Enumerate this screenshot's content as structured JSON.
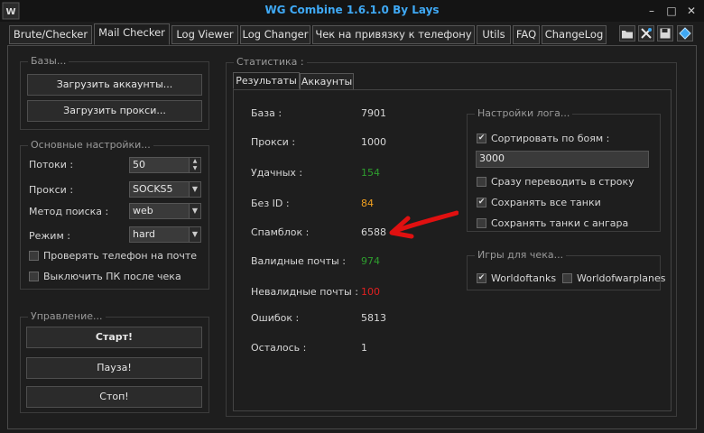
{
  "window": {
    "title": "WG Combine 1.6.1.0 By Lays",
    "minimize": "–",
    "maximize": "□",
    "close": "✕"
  },
  "tabs": [
    {
      "label": "Brute/Checker"
    },
    {
      "label": "Mail Checker",
      "active": true
    },
    {
      "label": "Log  Viewer"
    },
    {
      "label": "Log Changer"
    },
    {
      "label": "Чек на привязку к телефону"
    },
    {
      "label": "Utils"
    },
    {
      "label": "FAQ"
    },
    {
      "label": "ChangeLog"
    }
  ],
  "toolbar_icons": [
    "folder-icon",
    "tools-icon",
    "save-icon",
    "settings-icon"
  ],
  "bases": {
    "title": "Базы...",
    "load_accounts": "Загрузить аккаунты...",
    "load_proxy": "Загрузить прокси..."
  },
  "settings": {
    "title": "Основные настройки...",
    "threads_label": "Потоки :",
    "threads_value": "50",
    "proxy_label": "Прокси :",
    "proxy_value": "SOCKS5",
    "search_label": "Метод поиска :",
    "search_value": "web",
    "mode_label": "Режим  :",
    "mode_value": "hard",
    "check_phone": {
      "label": "Проверять телефон на почте",
      "checked": false
    },
    "shutdown_pc": {
      "label": "Выключить ПК после чека",
      "checked": false
    }
  },
  "control": {
    "title": "Управление...",
    "start": "Старт!",
    "pause": "Пауза!",
    "stop": "Стоп!"
  },
  "stats": {
    "title": "Статистика :",
    "tabs": [
      "Результаты",
      "Аккаунты"
    ],
    "rows": [
      {
        "label": "База :",
        "value": "7901",
        "color": "#d6d6d6"
      },
      {
        "label": "Прокси :",
        "value": "1000",
        "color": "#d6d6d6"
      },
      {
        "label": "Удачных :",
        "value": "154",
        "color": "#2e9e2e"
      },
      {
        "label": "Без ID :",
        "value": "84",
        "color": "#f0a020"
      },
      {
        "label": "Спамблок :",
        "value": "6588",
        "color": "#d6d6d6"
      },
      {
        "label": "Валидные почты :",
        "value": "974",
        "color": "#2e9e2e"
      },
      {
        "label": "Невалидные почты :",
        "value": "100",
        "color": "#e02020"
      },
      {
        "label": "Ошибок :",
        "value": "5813",
        "color": "#d6d6d6"
      },
      {
        "label": "Осталось :",
        "value": "1",
        "color": "#d6d6d6"
      }
    ]
  },
  "log_settings": {
    "title": "Настройки лога...",
    "sort_by_battles": {
      "label": "Сортировать по боям :",
      "checked": true
    },
    "battles_value": "3000",
    "to_string": {
      "label": "Сразу переводить в строку",
      "checked": false
    },
    "save_all_tanks": {
      "label": "Сохранять все танки",
      "checked": true
    },
    "save_hangar_tanks": {
      "label": "Сохранять танки с ангара",
      "checked": false
    }
  },
  "games": {
    "title": "Игры для чека...",
    "wot": {
      "label": "Worldoftanks",
      "checked": true
    },
    "wowp": {
      "label": "Worldofwarplanes",
      "checked": false
    }
  },
  "annotation": {
    "color": "#e01010"
  }
}
